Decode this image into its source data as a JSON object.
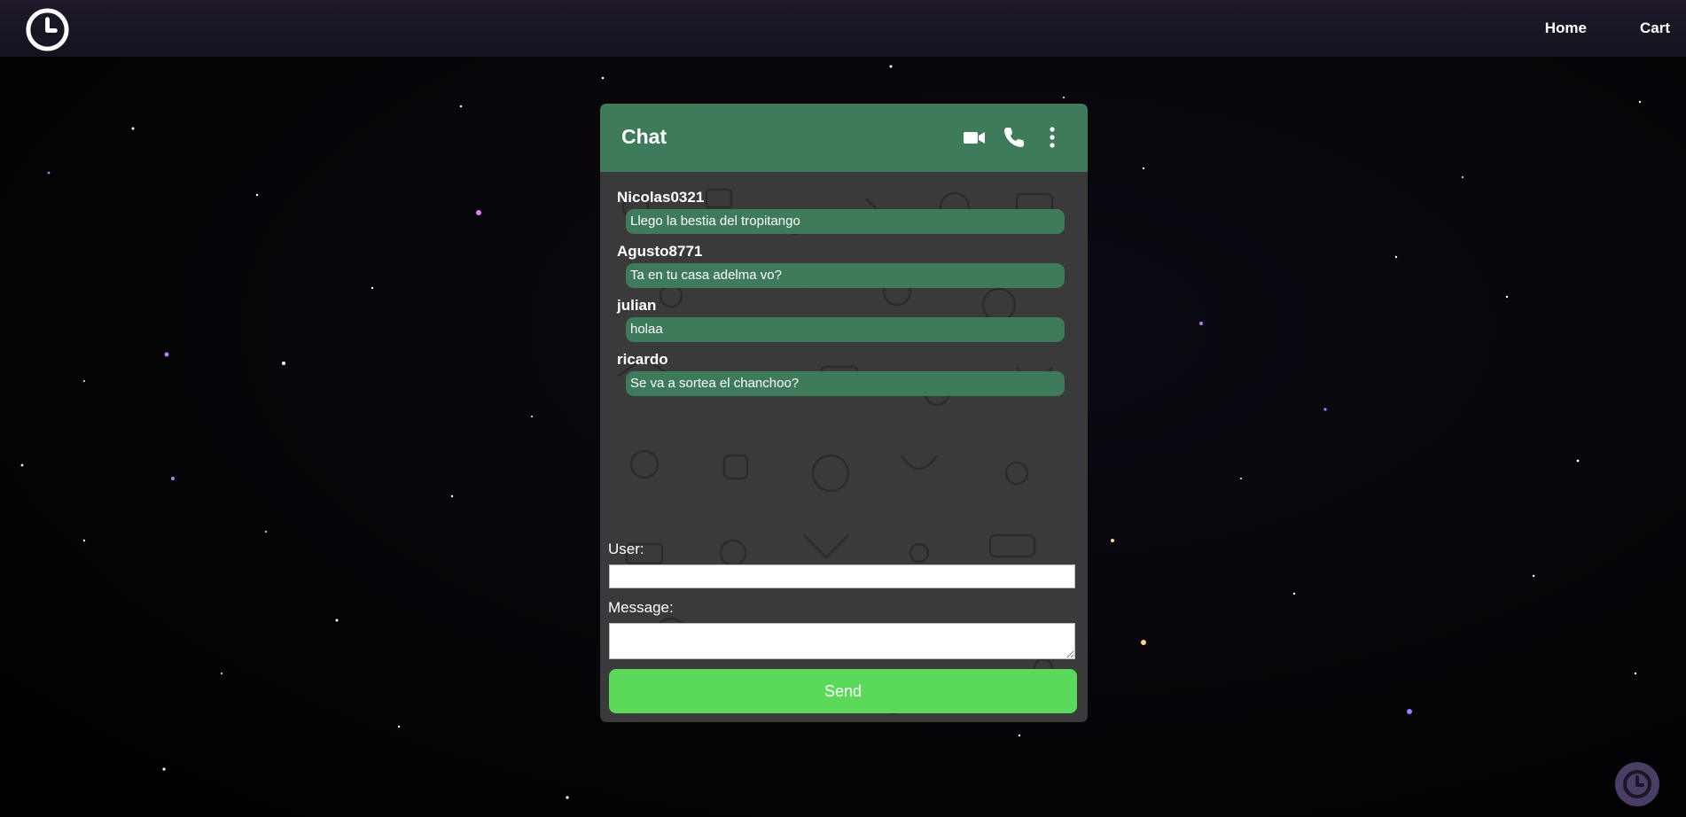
{
  "navbar": {
    "logo_icon": "clock-icon",
    "links": [
      {
        "label": "Home"
      },
      {
        "label": "Cart"
      }
    ]
  },
  "chat": {
    "title": "Chat",
    "header_icons": [
      "video-camera-icon",
      "phone-icon",
      "more-vertical-icon"
    ],
    "accent_color": "#3e7b5a",
    "messages": [
      {
        "user": "Nicolas0321",
        "text": "Llego la bestia del tropitango"
      },
      {
        "user": "Agusto8771",
        "text": "Ta en tu casa adelma vo?"
      },
      {
        "user": "julian",
        "text": "holaa"
      },
      {
        "user": "ricardo",
        "text": "Se va a sortea el chanchoo?"
      }
    ],
    "form": {
      "user_label": "User:",
      "user_value": "",
      "message_label": "Message:",
      "message_value": "",
      "send_label": "Send",
      "send_color": "#5bd95b"
    }
  },
  "floating_button": {
    "icon": "clock-icon",
    "color": "#4a3e66"
  }
}
